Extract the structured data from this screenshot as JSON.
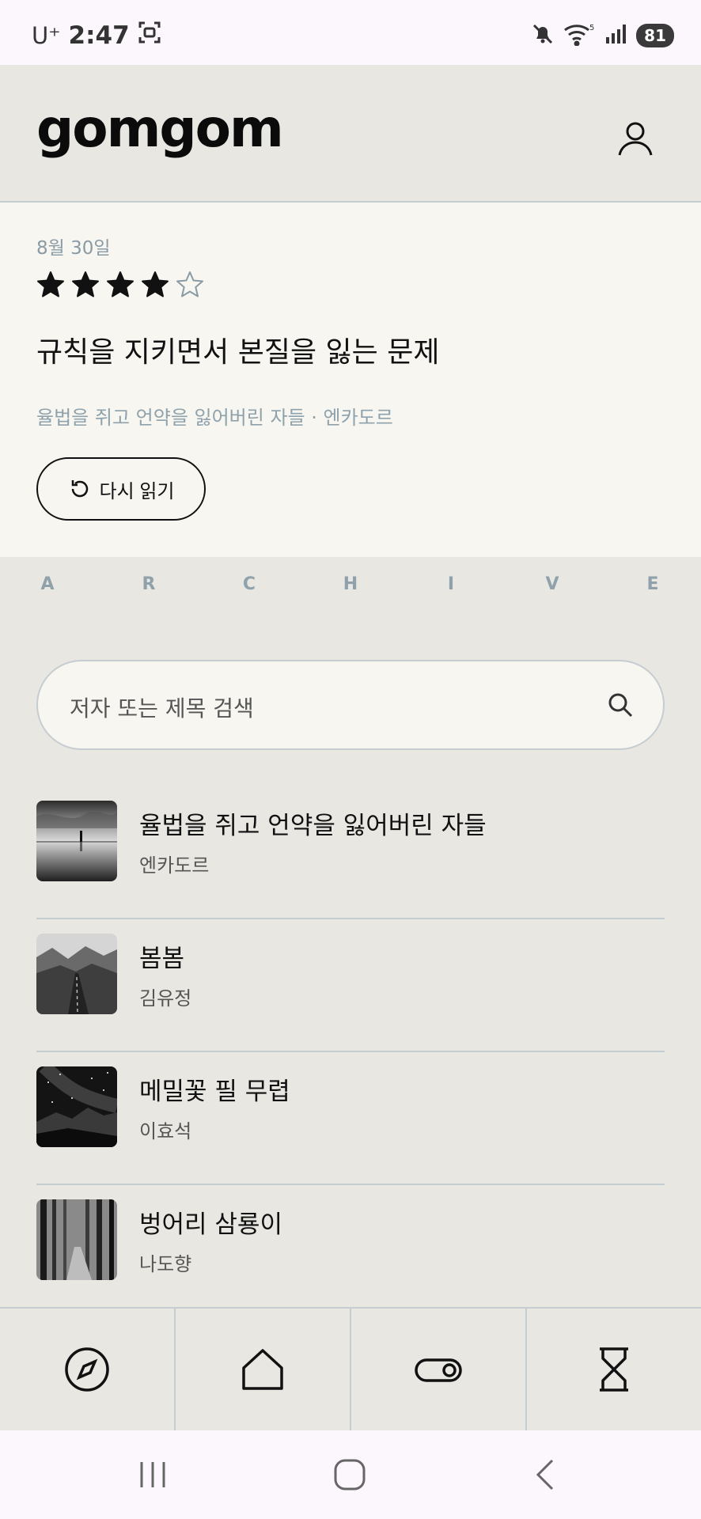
{
  "status_bar": {
    "carrier": "U⁺",
    "time": "2:47",
    "battery": "81",
    "icons": [
      "screenshot-icon",
      "mute-icon",
      "wifi-icon",
      "signal-icon",
      "battery-icon"
    ]
  },
  "header": {
    "logo": "gomgom",
    "profile_icon": "user-icon"
  },
  "featured": {
    "date": "8월 30일",
    "rating": 4,
    "rating_max": 5,
    "title": "규칙을 지키면서 본질을 잃는 문제",
    "subtitle": "율법을 쥐고 언약을 잃어버린 자들 · 엔카도르",
    "reread_label": "다시 읽기"
  },
  "archive": {
    "letters": [
      "A",
      "R",
      "C",
      "H",
      "I",
      "V",
      "E"
    ],
    "search_placeholder": "저자 또는 제목 검색",
    "items": [
      {
        "title": "율법을 쥐고 언약을 잃어버린 자들",
        "author": "엔카도르",
        "thumb": "lake-reflection-photo"
      },
      {
        "title": "봄봄",
        "author": "김유정",
        "thumb": "mountain-road-photo"
      },
      {
        "title": "메밀꽃 필 무렵",
        "author": "이효석",
        "thumb": "starry-mountain-photo"
      },
      {
        "title": "벙어리 삼룡이",
        "author": "나도향",
        "thumb": "forest-path-photo"
      }
    ]
  },
  "bottom_nav": [
    "compass-icon",
    "home-icon",
    "toggle-icon",
    "hourglass-icon"
  ],
  "system_nav": [
    "recents-icon",
    "home-circle-icon",
    "back-icon"
  ],
  "colors": {
    "background": "#e8e7e2",
    "card": "#f7f6f1",
    "muted_text": "#8fa2ab",
    "divider": "#c6cdd1"
  }
}
